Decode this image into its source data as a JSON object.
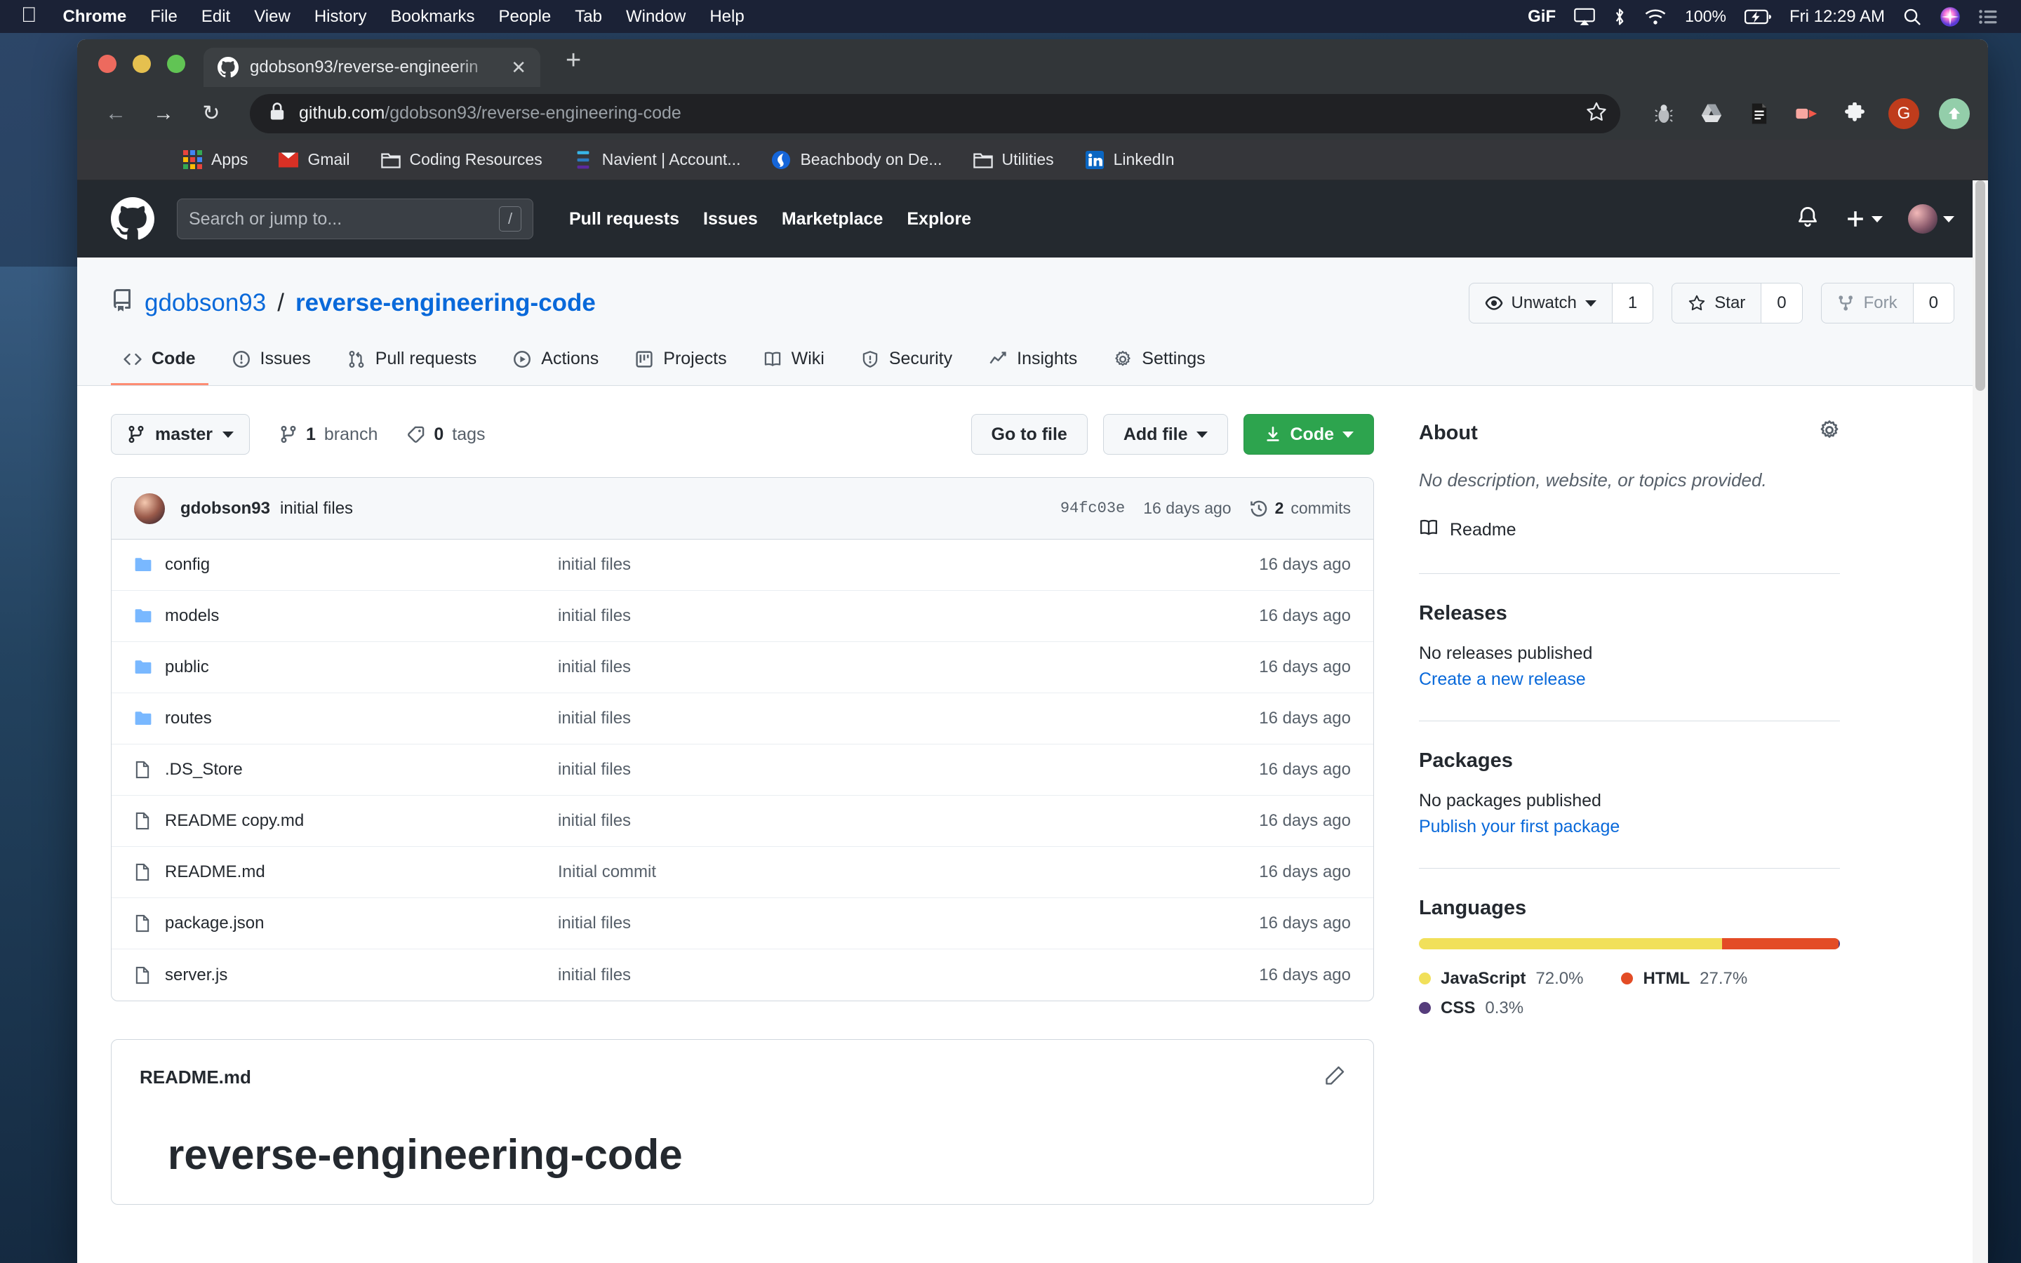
{
  "menubar": {
    "apple": "",
    "items": [
      "Chrome",
      "File",
      "Edit",
      "View",
      "History",
      "Bookmarks",
      "People",
      "Tab",
      "Window",
      "Help"
    ],
    "gif_label": "GiF",
    "battery": "100%",
    "clock": "Fri 12:29 AM"
  },
  "browser": {
    "tab": {
      "title": "gdobson93/reverse-engineerin",
      "close": "✕"
    },
    "new_tab": "+",
    "nav": {
      "back": "←",
      "forward": "→",
      "reload": "↻"
    },
    "omnibox": {
      "domain": "github.com",
      "path": "/gdobson93/reverse-engineering-code",
      "lock_icon": "lock-icon"
    },
    "profile_letter": "G",
    "bookmarks": [
      {
        "label": "Apps",
        "icon": "apps-grid-icon"
      },
      {
        "label": "Gmail",
        "icon": "gmail-icon"
      },
      {
        "label": "Coding Resources",
        "icon": "folder-icon"
      },
      {
        "label": "Navient | Account...",
        "icon": "navient-icon"
      },
      {
        "label": "Beachbody on De...",
        "icon": "beachbody-icon"
      },
      {
        "label": "Utilities",
        "icon": "folder-icon"
      },
      {
        "label": "LinkedIn",
        "icon": "linkedin-icon"
      }
    ]
  },
  "gh_header": {
    "search_placeholder": "Search or jump to...",
    "search_key": "/",
    "nav": [
      "Pull requests",
      "Issues",
      "Marketplace",
      "Explore"
    ]
  },
  "repo": {
    "owner": "gdobson93",
    "separator": "/",
    "name": "reverse-engineering-code",
    "actions": [
      {
        "label": "Unwatch",
        "count": "1",
        "icon": "eye-icon",
        "has_caret": true,
        "dim": false
      },
      {
        "label": "Star",
        "count": "0",
        "icon": "star-icon",
        "has_caret": false,
        "dim": false
      },
      {
        "label": "Fork",
        "count": "0",
        "icon": "fork-icon",
        "has_caret": false,
        "dim": true
      }
    ],
    "tabs": [
      {
        "label": "Code",
        "icon": "code-icon",
        "selected": true
      },
      {
        "label": "Issues",
        "icon": "issue-opened-icon",
        "selected": false
      },
      {
        "label": "Pull requests",
        "icon": "git-pull-request-icon",
        "selected": false
      },
      {
        "label": "Actions",
        "icon": "play-icon",
        "selected": false
      },
      {
        "label": "Projects",
        "icon": "project-icon",
        "selected": false
      },
      {
        "label": "Wiki",
        "icon": "book-icon",
        "selected": false
      },
      {
        "label": "Security",
        "icon": "shield-icon",
        "selected": false
      },
      {
        "label": "Insights",
        "icon": "graph-icon",
        "selected": false
      },
      {
        "label": "Settings",
        "icon": "gear-icon",
        "selected": false
      }
    ]
  },
  "toolbar": {
    "branch": "master",
    "branch_count": "1",
    "branch_word": "branch",
    "tag_count": "0",
    "tag_word": "tags",
    "go_to_file": "Go to file",
    "add_file": "Add file",
    "code": "Code"
  },
  "commit": {
    "author": "gdobson93",
    "message": "initial files",
    "sha": "94fc03e",
    "age": "16 days ago",
    "commits_count": "2",
    "commits_label": "commits"
  },
  "files": {
    "rows": [
      {
        "type": "folder",
        "name": "config",
        "message": "initial files",
        "age": "16 days ago"
      },
      {
        "type": "folder",
        "name": "models",
        "message": "initial files",
        "age": "16 days ago"
      },
      {
        "type": "folder",
        "name": "public",
        "message": "initial files",
        "age": "16 days ago"
      },
      {
        "type": "folder",
        "name": "routes",
        "message": "initial files",
        "age": "16 days ago"
      },
      {
        "type": "file",
        "name": ".DS_Store",
        "message": "initial files",
        "age": "16 days ago"
      },
      {
        "type": "file",
        "name": "README copy.md",
        "message": "initial files",
        "age": "16 days ago"
      },
      {
        "type": "file",
        "name": "README.md",
        "message": "Initial commit",
        "age": "16 days ago"
      },
      {
        "type": "file",
        "name": "package.json",
        "message": "initial files",
        "age": "16 days ago"
      },
      {
        "type": "file",
        "name": "server.js",
        "message": "initial files",
        "age": "16 days ago"
      }
    ]
  },
  "readme": {
    "filename": "README.md",
    "edit_icon": "pencil-icon",
    "heading": "reverse-engineering-code"
  },
  "sidebar": {
    "about_title": "About",
    "about_description": "No description, website, or topics provided.",
    "readme_link": "Readme",
    "releases_title": "Releases",
    "releases_empty": "No releases published",
    "releases_link": "Create a new release",
    "packages_title": "Packages",
    "packages_empty": "No packages published",
    "packages_link": "Publish your first package",
    "languages_title": "Languages",
    "languages": [
      {
        "name": "JavaScript",
        "pct": "72.0%",
        "value": 72.0,
        "color": "#f1e05a"
      },
      {
        "name": "HTML",
        "pct": "27.7%",
        "value": 27.7,
        "color": "#e34c26"
      },
      {
        "name": "CSS",
        "pct": "0.3%",
        "value": 0.3,
        "color": "#563d7c"
      }
    ]
  }
}
